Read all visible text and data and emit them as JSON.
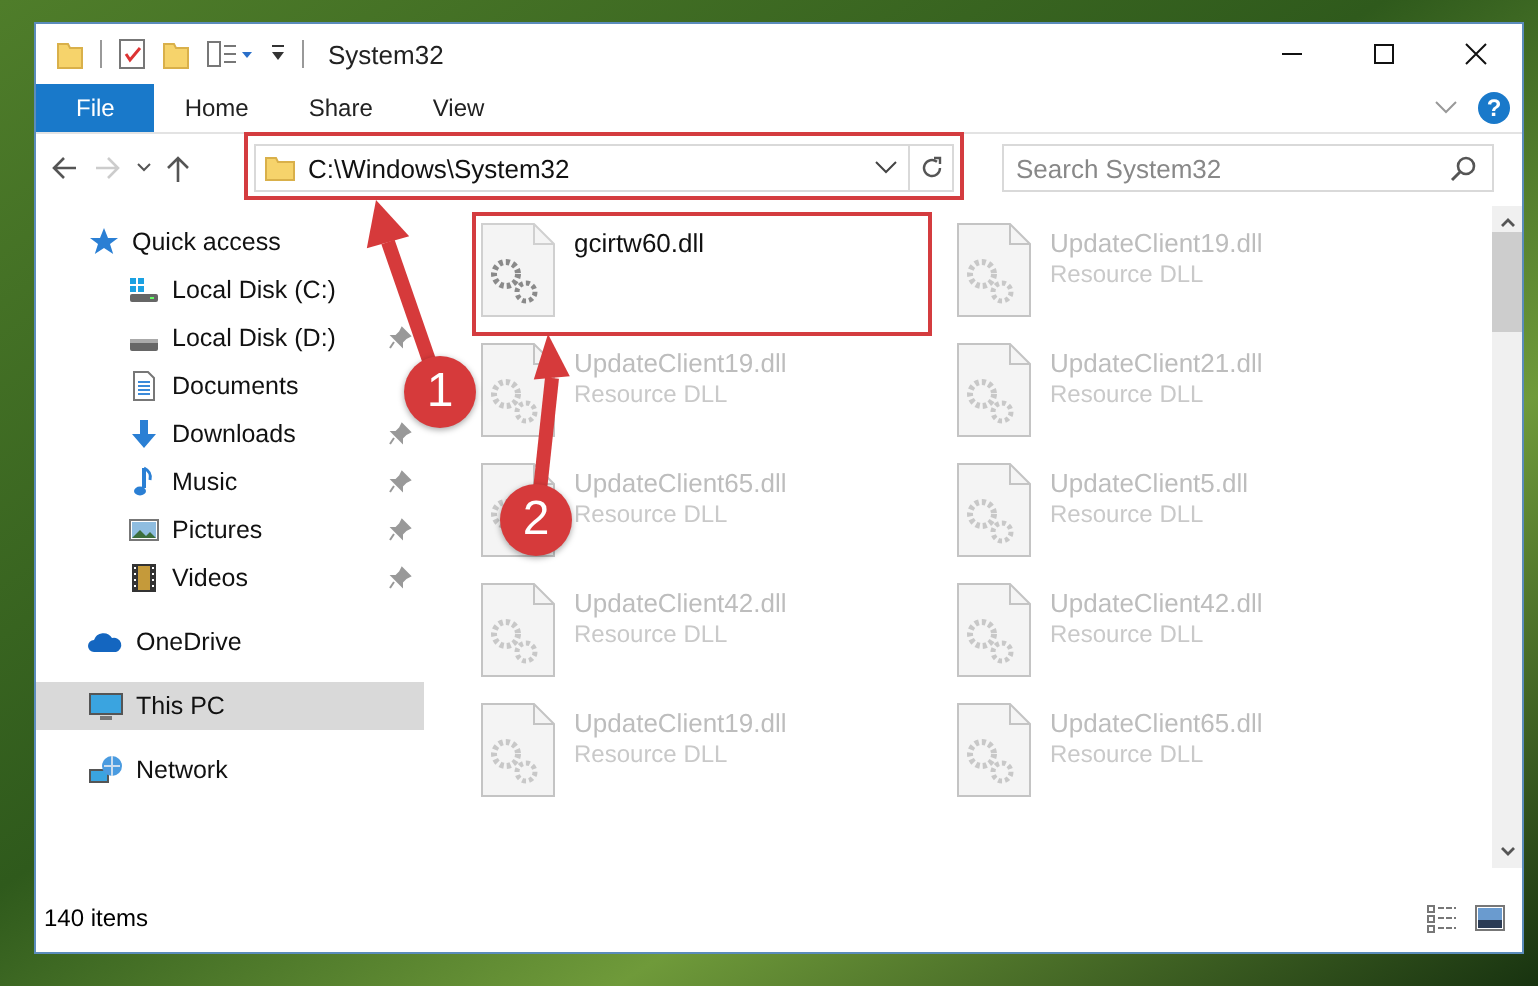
{
  "window": {
    "title": "System32"
  },
  "ribbon": {
    "tabs": [
      {
        "label": "File",
        "kind": "file"
      },
      {
        "label": "Home",
        "kind": "tab"
      },
      {
        "label": "Share",
        "kind": "tab"
      },
      {
        "label": "View",
        "kind": "tab"
      }
    ],
    "help_button": "?"
  },
  "address_bar": {
    "path": "C:\\Windows\\System32"
  },
  "search": {
    "placeholder": "Search System32"
  },
  "sidebar": {
    "items": [
      {
        "label": "Quick access",
        "selected": false,
        "children": [
          {
            "label": "Local Disk (C:)",
            "selected": false,
            "pinned": false
          },
          {
            "label": "Local Disk (D:)",
            "selected": false,
            "pinned": true
          },
          {
            "label": "Documents",
            "selected": false,
            "pinned": false
          },
          {
            "label": "Downloads",
            "selected": false,
            "pinned": true
          },
          {
            "label": "Music",
            "selected": false,
            "pinned": true
          },
          {
            "label": "Pictures",
            "selected": false,
            "pinned": true
          },
          {
            "label": "Videos",
            "selected": false,
            "pinned": true
          }
        ]
      },
      {
        "label": "OneDrive",
        "selected": false
      },
      {
        "label": "This PC",
        "selected": true
      },
      {
        "label": "Network",
        "selected": false
      }
    ]
  },
  "files": [
    {
      "name": "gcirtw60.dll",
      "dimmed": false
    },
    {
      "name": "UpdateClient19.dll",
      "type": "Resource DLL",
      "dimmed": true
    },
    {
      "name": "UpdateClient19.dll",
      "type": "Resource DLL",
      "dimmed": true
    },
    {
      "name": "UpdateClient21.dll",
      "type": "Resource DLL",
      "dimmed": true
    },
    {
      "name": "UpdateClient65.dll",
      "type": "Resource DLL",
      "dimmed": true
    },
    {
      "name": "UpdateClient5.dll",
      "type": "Resource DLL",
      "dimmed": true
    },
    {
      "name": "UpdateClient42.dll",
      "type": "Resource DLL",
      "dimmed": true
    },
    {
      "name": "UpdateClient42.dll",
      "type": "Resource DLL",
      "dimmed": true
    },
    {
      "name": "UpdateClient19.dll",
      "type": "Resource DLL",
      "dimmed": true
    },
    {
      "name": "UpdateClient65.dll",
      "type": "Resource DLL",
      "dimmed": true
    }
  ],
  "status_bar": {
    "item_count": "140 items"
  },
  "annotations": [
    {
      "label": "1"
    },
    {
      "label": "2"
    }
  ]
}
